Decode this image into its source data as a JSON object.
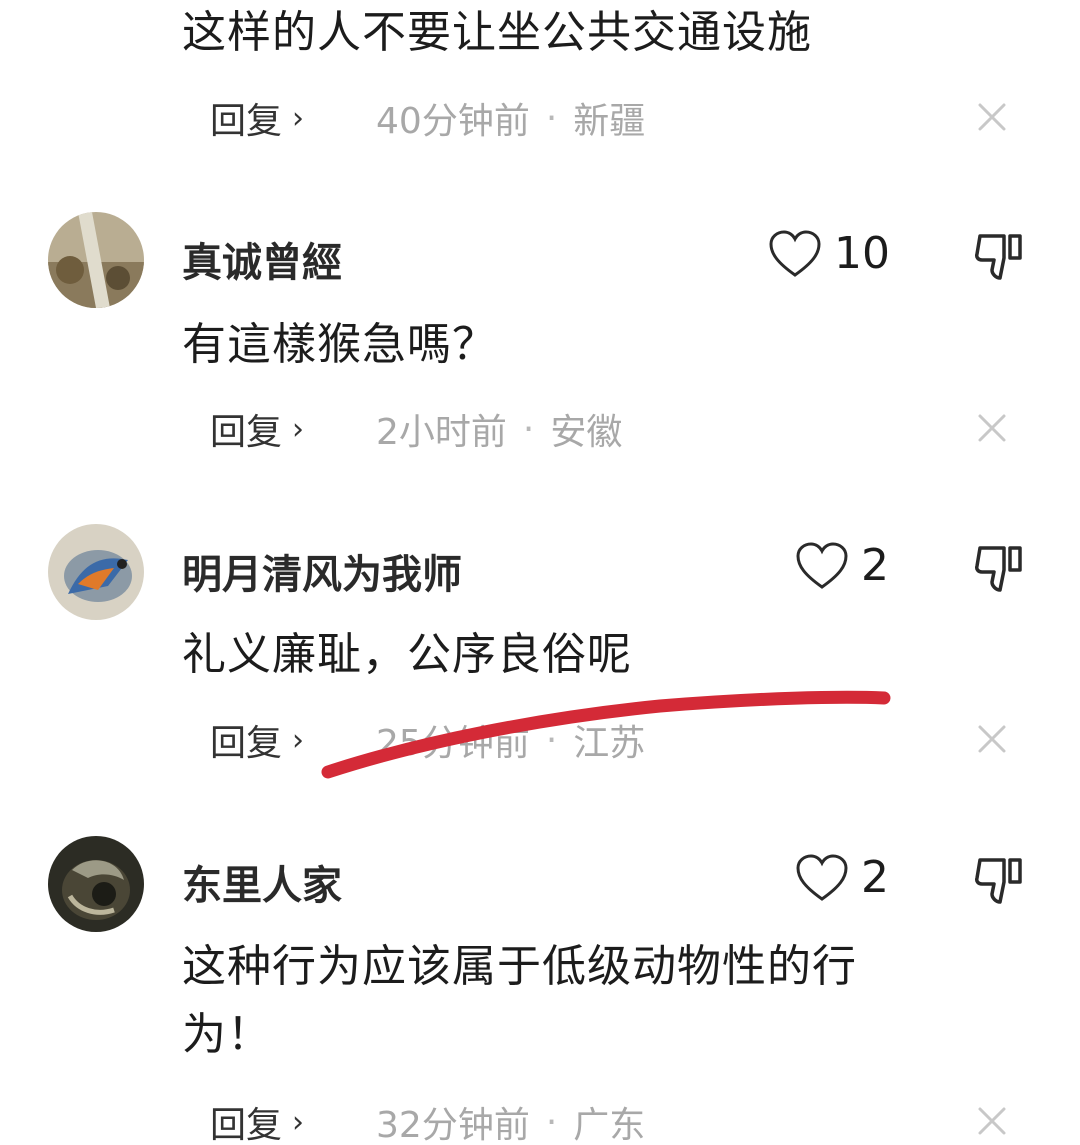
{
  "comments": [
    {
      "text": "这样的人不要让坐公共交通设施",
      "reply_label": "回复",
      "time": "40分钟前",
      "location": "新疆"
    },
    {
      "username": "真诚曾經",
      "likes": "10",
      "text": "有這樣猴急嗎？",
      "reply_label": "回复",
      "time": "2小时前",
      "location": "安徽"
    },
    {
      "username": "明月清风为我师",
      "likes": "2",
      "text": "礼义廉耻，公序良俗呢",
      "reply_label": "回复",
      "time": "25分钟前",
      "location": "江苏"
    },
    {
      "username": "东里人家",
      "likes": "2",
      "text_line1": "这种行为应该属于低级动物性的行",
      "text_line2": "为！",
      "reply_label": "回复",
      "time": "32分钟前",
      "location": "广东"
    }
  ],
  "colors": {
    "annotation_red": "#d42a37",
    "meta_gray": "#a8a8a8"
  },
  "icons": {
    "like": "heart-icon",
    "dislike": "thumbs-down-icon",
    "close": "close-icon",
    "reply": "chevron-right-icon"
  }
}
